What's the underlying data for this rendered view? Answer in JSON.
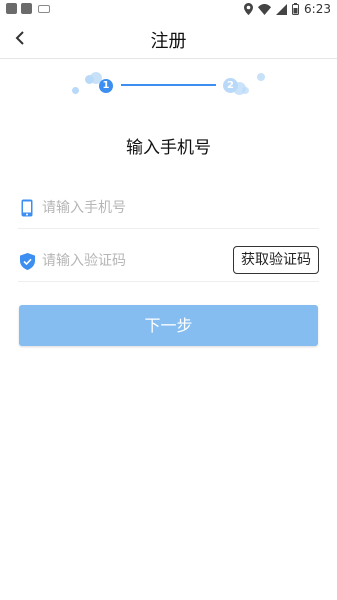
{
  "status_bar": {
    "time": "6:23"
  },
  "header": {
    "title": "注册",
    "back_icon": "chevron-left-icon"
  },
  "stepper": {
    "step1": "1",
    "step2": "2",
    "current_step": 1
  },
  "section_title": "输入手机号",
  "phone_field": {
    "placeholder": "请输入手机号",
    "value": "",
    "icon": "phone-icon"
  },
  "code_field": {
    "placeholder": "请输入验证码",
    "value": "",
    "icon": "shield-check-icon",
    "button_label": "获取验证码"
  },
  "next_button": {
    "label": "下一步"
  },
  "colors": {
    "accent": "#3c8ef0",
    "button_disabled": "#86bdf0",
    "step_inactive": "#b9d9f8"
  }
}
